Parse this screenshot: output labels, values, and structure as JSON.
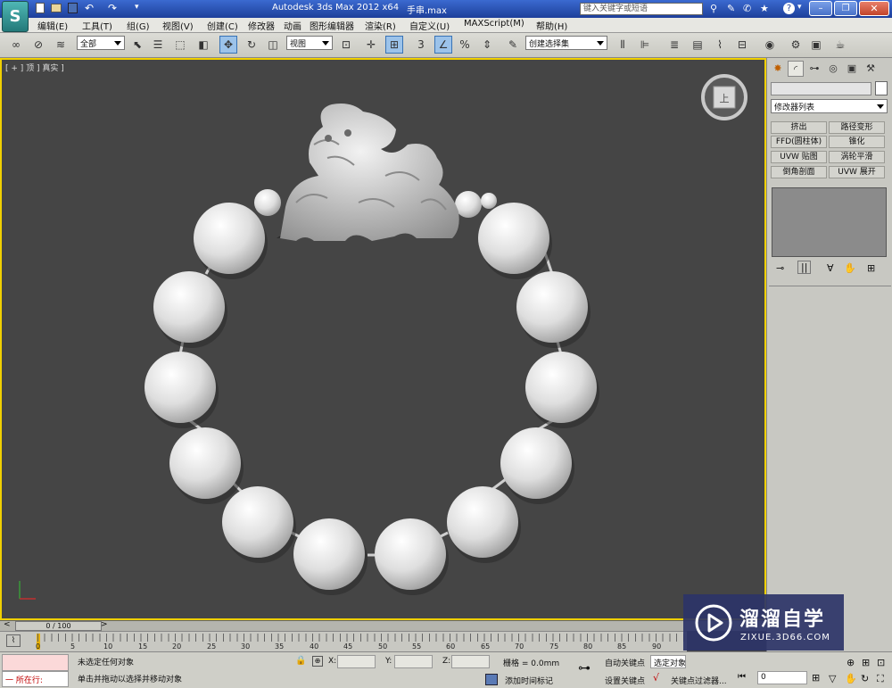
{
  "titlebar": {
    "app_title": "Autodesk 3ds Max  2012 x64",
    "file_name": "手串.max",
    "search_placeholder": "键入关键字或短语",
    "help_label": "?",
    "window_controls": [
      "minimize",
      "restore",
      "close"
    ]
  },
  "menu": {
    "items": [
      "编辑(E)",
      "工具(T)",
      "组(G)",
      "视图(V)",
      "创建(C)",
      "修改器",
      "动画",
      "图形编辑器",
      "渲染(R)",
      "自定义(U)",
      "MAXScript(M)",
      "帮助(H)"
    ]
  },
  "toolbar": {
    "selection_filter": "全部",
    "ref_coord": "视图",
    "named_selection": "创建选择集",
    "snap_label": "3"
  },
  "viewport": {
    "label": "[ + ] 顶 ] 真实 ]",
    "viewcube_label": "上",
    "object_color": "#dcdcdc",
    "background_color": "#454545",
    "border_color": "#f0d000"
  },
  "command_panel": {
    "name_field": "",
    "modifier_list": "修改器列表",
    "modifier_buttons": [
      "挤出",
      "路径变形",
      "FFD(圆柱体)",
      "锥化",
      "UVW 贴图",
      "涡轮平滑",
      "倒角剖面",
      "UVW 展开"
    ],
    "color_swatch": "#ffffff"
  },
  "timeline": {
    "frame_display": "0 / 100",
    "ticks": [
      "0",
      "5",
      "10",
      "15",
      "20",
      "25",
      "30",
      "35",
      "40",
      "45",
      "50",
      "55",
      "60",
      "65",
      "70",
      "75",
      "80",
      "85",
      "90"
    ]
  },
  "status": {
    "script_label": "一  所在行:",
    "selection_status": "未选定任何对象",
    "prompt": "单击并拖动以选择并移动对象",
    "x_label": "X:",
    "y_label": "Y:",
    "z_label": "Z:",
    "grid": "栅格 = 0.0mm",
    "add_time_tag": "添加时间标记",
    "auto_key": "自动关键点",
    "auto_key_select": "选定对象",
    "set_key": "设置关键点",
    "key_filters": "关键点过滤器...",
    "frame_value": "0"
  },
  "watermark": {
    "brand": "溜溜自学",
    "url": "ZIXUE.3D66.COM"
  }
}
